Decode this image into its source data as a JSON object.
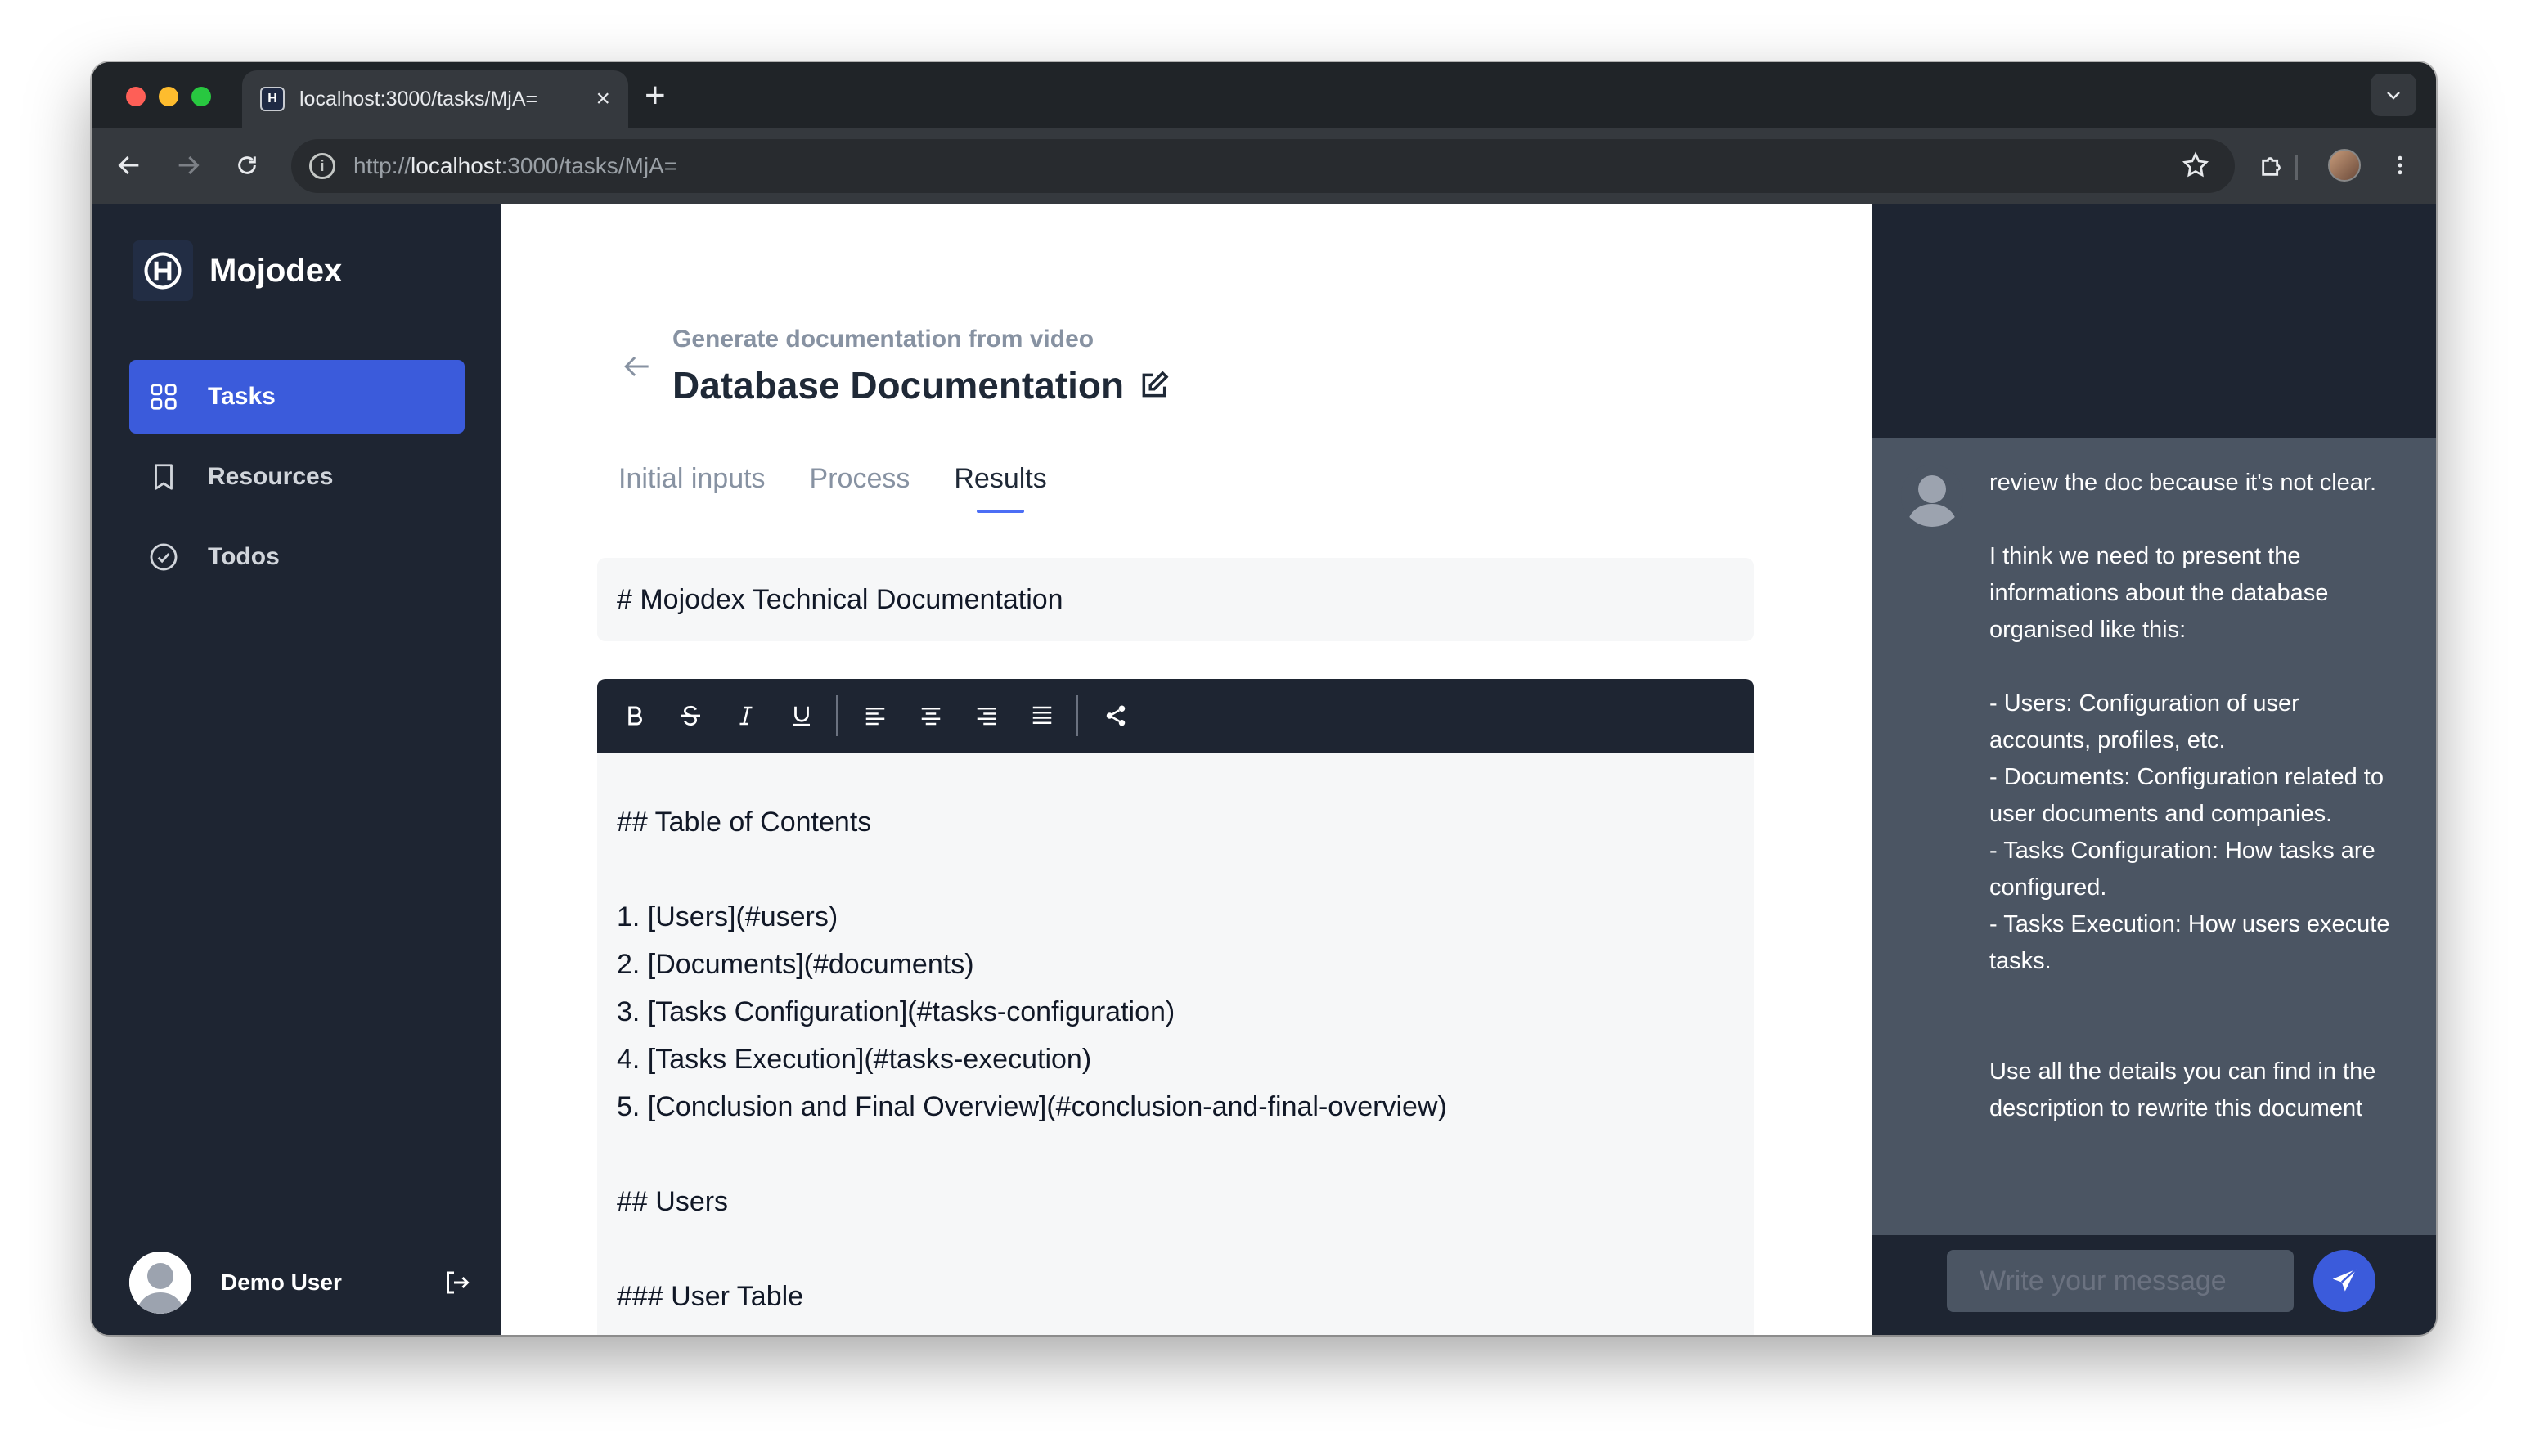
{
  "browser": {
    "tab_title": "localhost:3000/tasks/MjA=",
    "tab_favicon": "H",
    "url_scheme": "http://",
    "url_host": "localhost",
    "url_path": ":3000/tasks/MjA="
  },
  "sidebar": {
    "brand": "Mojodex",
    "items": [
      {
        "label": "Tasks",
        "icon": "grid-icon",
        "active": true
      },
      {
        "label": "Resources",
        "icon": "bookmark-icon",
        "active": false
      },
      {
        "label": "Todos",
        "icon": "check-circle-icon",
        "active": false
      }
    ],
    "user_name": "Demo User"
  },
  "task": {
    "subtitle": "Generate documentation from video",
    "title": "Database Documentation",
    "tabs": [
      "Initial inputs",
      "Process",
      "Results"
    ],
    "active_tab": "Results",
    "doc_title": "# Mojodex Technical Documentation",
    "editor_lines": [
      "## Table of Contents",
      "",
      "1. [Users](#users)",
      "2. [Documents](#documents)",
      "3. [Tasks Configuration](#tasks-configuration)",
      "4. [Tasks Execution](#tasks-execution)",
      "5. [Conclusion and Final Overview](#conclusion-and-final-overview)",
      "",
      "## Users",
      "",
      "### User Table"
    ]
  },
  "chat": {
    "message": "review the doc because it's not clear.\n\nI think we need to present the informations about the database organised like this:\n\n- Users: Configuration of user accounts, profiles, etc.\n- Documents: Configuration related to user documents and companies.\n- Tasks Configuration: How tasks are configured.\n- Tasks Execution: How users execute tasks.\n\n\nUse all the details you can find in the description to rewrite this document",
    "input_placeholder": "Write your message"
  },
  "colors": {
    "accent": "#3b5bdb",
    "sidebar_bg": "#1e2532",
    "chat_bg": "#4b5563"
  }
}
